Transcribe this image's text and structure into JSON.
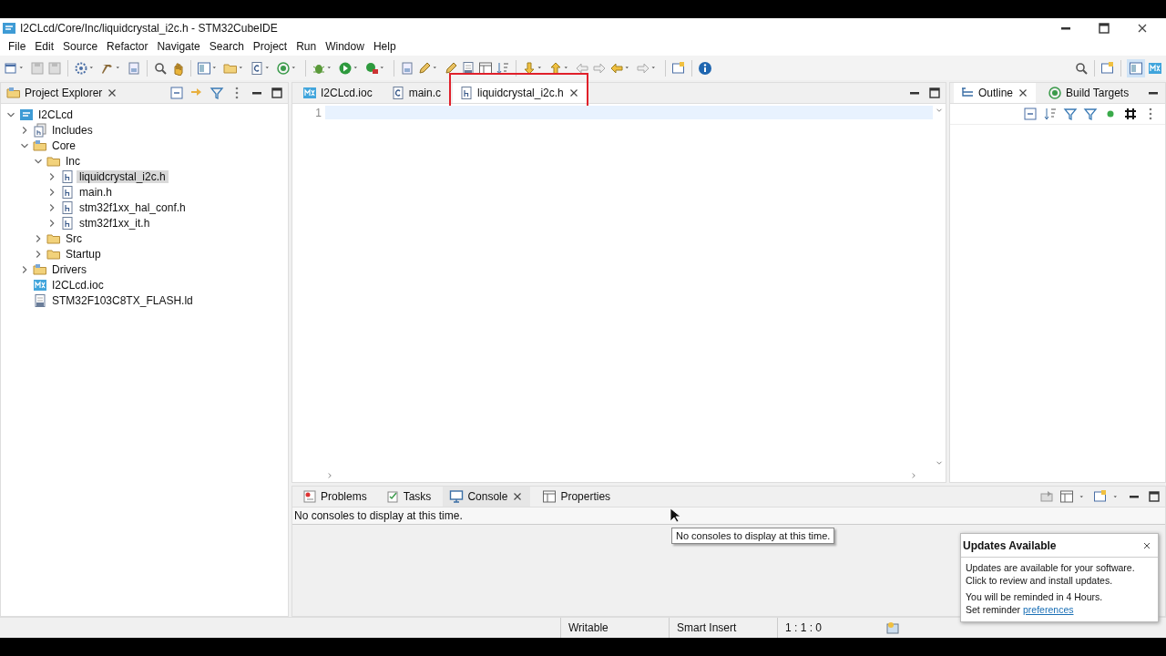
{
  "window": {
    "title": "I2CLcd/Core/Inc/liquidcrystal_i2c.h - STM32CubeIDE"
  },
  "menu": [
    "File",
    "Edit",
    "Source",
    "Refactor",
    "Navigate",
    "Search",
    "Project",
    "Run",
    "Window",
    "Help"
  ],
  "project_explorer": {
    "title": "Project Explorer",
    "tree": [
      {
        "label": "I2CLcd",
        "kind": "project",
        "expanded": true,
        "selected": false,
        "children": [
          {
            "label": "Includes",
            "kind": "includes",
            "expanded": false,
            "selected": false
          },
          {
            "label": "Core",
            "kind": "source-folder",
            "expanded": true,
            "selected": false,
            "children": [
              {
                "label": "Inc",
                "kind": "folder",
                "expanded": true,
                "selected": false,
                "children": [
                  {
                    "label": "liquidcrystal_i2c.h",
                    "kind": "header",
                    "expanded": false,
                    "selected": true
                  },
                  {
                    "label": "main.h",
                    "kind": "header",
                    "expanded": false,
                    "selected": false
                  },
                  {
                    "label": "stm32f1xx_hal_conf.h",
                    "kind": "header",
                    "expanded": false,
                    "selected": false
                  },
                  {
                    "label": "stm32f1xx_it.h",
                    "kind": "header",
                    "expanded": false,
                    "selected": false
                  }
                ]
              },
              {
                "label": "Src",
                "kind": "folder",
                "expanded": false,
                "selected": false
              },
              {
                "label": "Startup",
                "kind": "folder",
                "expanded": false,
                "selected": false
              }
            ]
          },
          {
            "label": "Drivers",
            "kind": "source-folder",
            "expanded": false,
            "selected": false
          },
          {
            "label": "I2CLcd.ioc",
            "kind": "mx",
            "selected": false
          },
          {
            "label": "STM32F103C8TX_FLASH.ld",
            "kind": "linker",
            "selected": false
          }
        ]
      }
    ]
  },
  "editor": {
    "tabs": [
      {
        "label": "I2CLcd.ioc",
        "kind": "mx",
        "selected": false
      },
      {
        "label": "main.c",
        "kind": "source",
        "selected": false
      },
      {
        "label": "liquidcrystal_i2c.h",
        "kind": "header",
        "selected": true
      }
    ],
    "line_numbers": [
      "1"
    ]
  },
  "side_panel": {
    "tabs": [
      {
        "label": "Outline",
        "kind": "outline",
        "selected": true
      },
      {
        "label": "Build Targets",
        "kind": "targets",
        "selected": false
      }
    ]
  },
  "bottom_panel": {
    "tabs": [
      {
        "label": "Problems",
        "kind": "problems",
        "selected": false
      },
      {
        "label": "Tasks",
        "kind": "tasks",
        "selected": false
      },
      {
        "label": "Console",
        "kind": "console",
        "selected": true
      },
      {
        "label": "Properties",
        "kind": "properties",
        "selected": false
      }
    ],
    "message": "No consoles to display at this time."
  },
  "tooltip": "No consoles to display at this time.",
  "status_bar": {
    "fields": [
      "Writable",
      "Smart Insert",
      "1 : 1 : 0"
    ]
  },
  "notification": {
    "title": "Updates Available",
    "lines": [
      "Updates are available for your software.",
      "Click to review and install updates."
    ],
    "reminder": "You will be reminded in 4 Hours.",
    "reminder_prefix": "Set reminder",
    "reminder_link": "preferences"
  }
}
